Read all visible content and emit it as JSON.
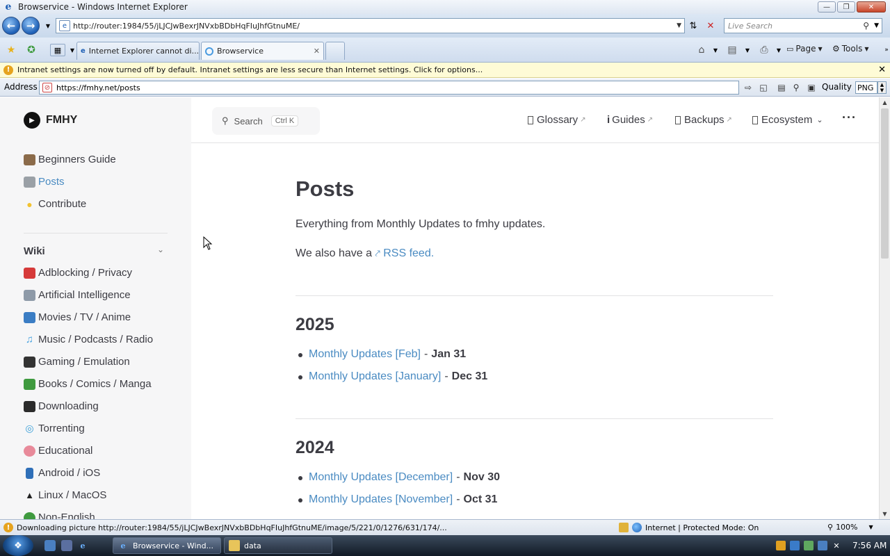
{
  "window": {
    "title": "Browservice - Windows Internet Explorer"
  },
  "navbar": {
    "url": "http://router:1984/55/jLJCJwBexrJNVxbBDbHqFIuJhfGtnuME/",
    "search_placeholder": "Live Search"
  },
  "tabs": [
    {
      "label": "Internet Explorer cannot di..."
    },
    {
      "label": "Browservice"
    }
  ],
  "commands": {
    "page": "Page",
    "tools": "Tools"
  },
  "infobar": {
    "message": "Intranet settings are now turned off by default. Intranet settings are less secure than Internet settings. Click for options..."
  },
  "addressbar": {
    "label": "Address",
    "url": "https://fmhy.net/posts",
    "quality_label": "Quality",
    "quality_value": "PNG"
  },
  "site": {
    "brand": "FMHY",
    "search": {
      "placeholder": "Search",
      "shortcut": "Ctrl K"
    },
    "topnav": [
      "Glossary",
      "Guides",
      "Backups",
      "Ecosystem"
    ],
    "sidebar": {
      "top_items": [
        {
          "label": "Beginners Guide",
          "icon": "books-icon",
          "color": "#8b6b4a"
        },
        {
          "label": "Posts",
          "icon": "newspaper-icon",
          "color": "#9aa0a6"
        },
        {
          "label": "Contribute",
          "icon": "lightbulb-icon",
          "color": "#f2c230"
        }
      ],
      "section_title": "Wiki",
      "wiki_items": [
        {
          "label": "Adblocking / Privacy",
          "icon": "stop-sign-icon",
          "color": "#d63a3a"
        },
        {
          "label": "Artificial Intelligence",
          "icon": "robot-icon",
          "color": "#8e9aa8"
        },
        {
          "label": "Movies / TV / Anime",
          "icon": "tv-icon",
          "color": "#3b7dc4"
        },
        {
          "label": "Music / Podcasts / Radio",
          "icon": "music-note-icon",
          "color": "#4aa3e0"
        },
        {
          "label": "Gaming / Emulation",
          "icon": "gamepad-icon",
          "color": "#333333"
        },
        {
          "label": "Books / Comics / Manga",
          "icon": "book-icon",
          "color": "#3f9a3f"
        },
        {
          "label": "Downloading",
          "icon": "floppy-disk-icon",
          "color": "#2b2b2b"
        },
        {
          "label": "Torrenting",
          "icon": "cyclone-icon",
          "color": "#3a9fd8"
        },
        {
          "label": "Educational",
          "icon": "brain-icon",
          "color": "#e88a9a"
        },
        {
          "label": "Android / iOS",
          "icon": "phone-icon",
          "color": "#2f6fb8"
        },
        {
          "label": "Linux / MacOS",
          "icon": "penguin-icon",
          "color": "#222222"
        },
        {
          "label": "Non-English",
          "icon": "globe-icon",
          "color": "#3f9a3f"
        }
      ]
    },
    "main": {
      "title": "Posts",
      "intro": "Everything from Monthly Updates to fmhy updates.",
      "rss_prefix": "We also have a",
      "rss_link": "RSS feed.",
      "sections": [
        {
          "year": "2025",
          "posts": [
            {
              "title": "Monthly Updates [Feb]",
              "date": "Jan 31"
            },
            {
              "title": "Monthly Updates [January]",
              "date": "Dec 31"
            }
          ]
        },
        {
          "year": "2024",
          "posts": [
            {
              "title": "Monthly Updates [December]",
              "date": "Nov 30"
            },
            {
              "title": "Monthly Updates [November]",
              "date": "Oct 31"
            }
          ]
        }
      ]
    }
  },
  "statusbar": {
    "message": "Downloading picture http://router:1984/55/jLJCJwBexrJNVxbBDbHqFIuJhfGtnuME/image/5/221/0/1276/631/174/...",
    "zone": "Internet | Protected Mode: On",
    "zoom": "100%"
  },
  "taskbar": {
    "tasks": [
      "Browservice - Wind...",
      "data"
    ],
    "clock": "7:56 AM"
  }
}
